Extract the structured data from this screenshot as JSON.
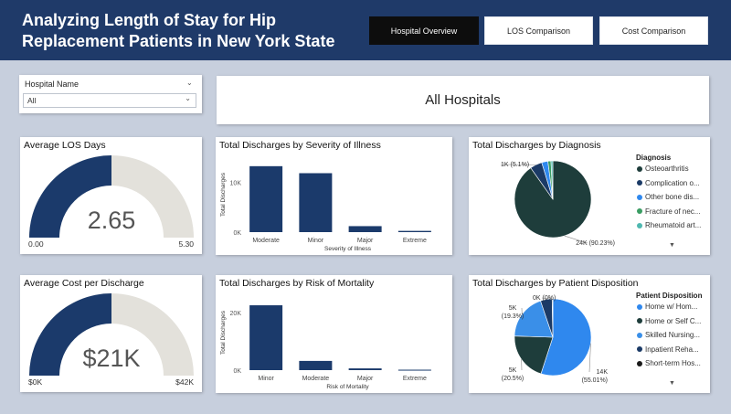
{
  "header": {
    "title": "Analyzing Length of Stay for Hip Replacement Patients in New York State",
    "tabs": [
      {
        "label": "Hospital Overview",
        "active": true
      },
      {
        "label": "LOS Comparison",
        "active": false
      },
      {
        "label": "Cost Comparison",
        "active": false
      }
    ]
  },
  "filter": {
    "label": "Hospital Name",
    "value": "All"
  },
  "banner": {
    "text": "All Hospitals"
  },
  "gauges": {
    "los": {
      "title": "Average LOS Days",
      "value_label": "2.65",
      "min_label": "0.00",
      "max_label": "5.30",
      "fraction": 0.5
    },
    "cost": {
      "title": "Average Cost per Discharge",
      "value_label": "$21K",
      "min_label": "$0K",
      "max_label": "$42K",
      "fraction": 0.5
    }
  },
  "chart_data": [
    {
      "type": "bar",
      "title": "Total Discharges by Severity of Illness",
      "xlabel": "Severity of Illness",
      "ylabel": "Total Discharges",
      "categories": [
        "Moderate",
        "Minor",
        "Major",
        "Extreme"
      ],
      "values": [
        13200,
        11800,
        1200,
        250
      ],
      "ylim": [
        0,
        15000
      ],
      "yticks": [
        {
          "value": 0,
          "label": "0K"
        },
        {
          "value": 10000,
          "label": "10K"
        }
      ]
    },
    {
      "type": "bar",
      "title": "Total Discharges by Risk of Mortality",
      "xlabel": "Risk of Mortality",
      "ylabel": "Total Discharges",
      "categories": [
        "Minor",
        "Moderate",
        "Major",
        "Extreme"
      ],
      "values": [
        22500,
        3200,
        600,
        150
      ],
      "ylim": [
        0,
        26000
      ],
      "yticks": [
        {
          "value": 0,
          "label": "0K"
        },
        {
          "value": 20000,
          "label": "20K"
        }
      ]
    },
    {
      "type": "pie",
      "title": "Total Discharges by Diagnosis",
      "legend_title": "Diagnosis",
      "labels": [
        "Osteoarthritis",
        "Complication o...",
        "Other bone dis...",
        "Fracture of nec...",
        "Rheumatoid art..."
      ],
      "values": [
        90.23,
        5.1,
        2.6,
        1.3,
        0.77
      ],
      "colors": [
        "#1e3d3b",
        "#1b3a66",
        "#2f88ee",
        "#3a9d63",
        "#4fb8b0"
      ],
      "data_labels": [
        {
          "text": "24K (90.23%)",
          "slice": 0
        },
        {
          "text": "1K (5.1%)",
          "slice": 1
        }
      ]
    },
    {
      "type": "pie",
      "title": "Total Discharges by Patient Disposition",
      "legend_title": "Patient Disposition",
      "labels": [
        "Home w/ Hom...",
        "Home or Self C...",
        "Skilled Nursing...",
        "Inpatient Reha...",
        "Short-term Hos..."
      ],
      "values": [
        55.01,
        20.5,
        19.3,
        4.9,
        0.29
      ],
      "colors": [
        "#2f88ee",
        "#1e3d3b",
        "#3a8fe8",
        "#1b3a66",
        "#1a1a1a"
      ],
      "data_labels": [
        {
          "text": "14K",
          "text2": "(55.01%)",
          "slice": 0
        },
        {
          "text": "5K",
          "text2": "(20.5%)",
          "slice": 1
        },
        {
          "text": "5K",
          "text2": "(19.3%)",
          "slice": 2
        },
        {
          "text": "0K (0%)",
          "slice": 4
        }
      ]
    }
  ],
  "colors": {
    "header_bg": "#1f3a69",
    "bar": "#1b3a6b",
    "gauge_fill": "#1b3a6b",
    "gauge_track": "#e3e1db",
    "page_bg": "#c7cfdd"
  }
}
